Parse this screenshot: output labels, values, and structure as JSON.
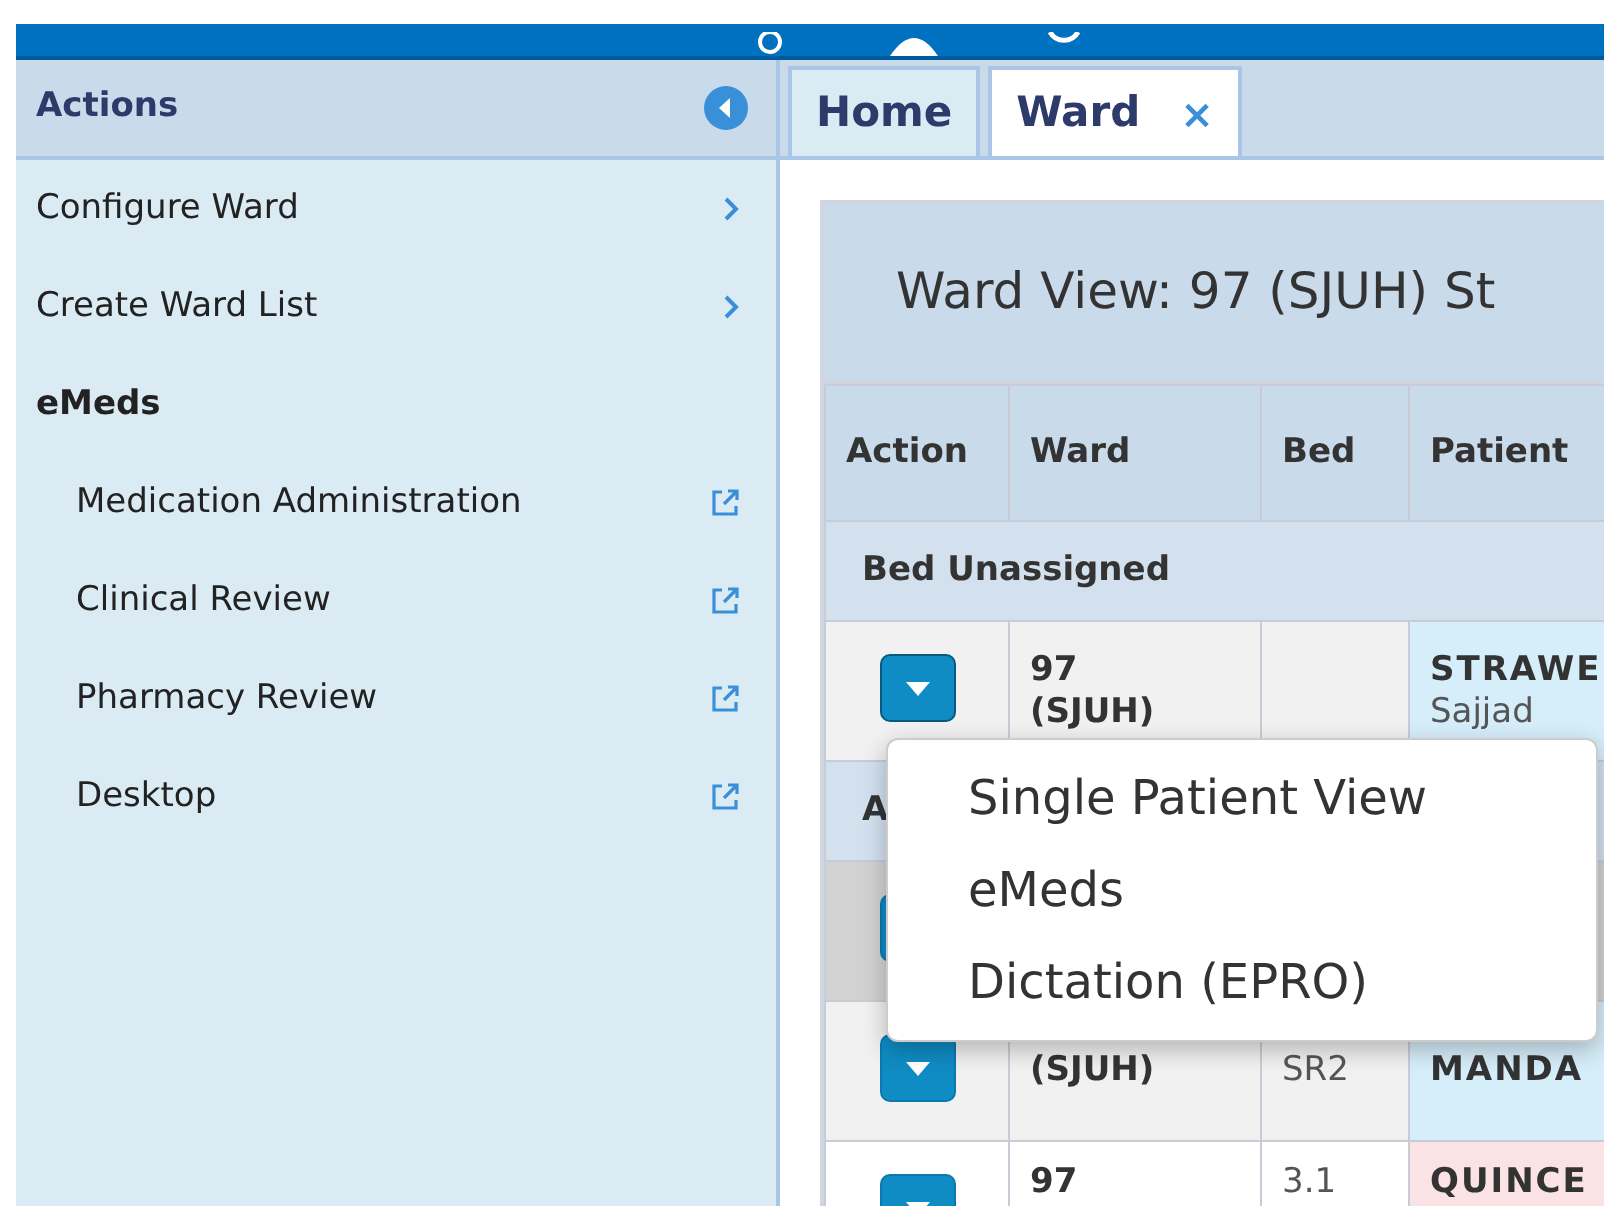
{
  "sidebar": {
    "title": "Actions",
    "items": [
      {
        "label": "Configure Ward",
        "kind": "submenu"
      },
      {
        "label": "Create Ward List",
        "kind": "submenu"
      },
      {
        "label": "eMeds",
        "kind": "section",
        "children": [
          {
            "label": "Medication Administration",
            "kind": "external"
          },
          {
            "label": "Clinical Review",
            "kind": "external"
          },
          {
            "label": "Pharmacy Review",
            "kind": "external"
          },
          {
            "label": "Desktop",
            "kind": "external"
          }
        ]
      }
    ]
  },
  "tabs": [
    {
      "label": "Home",
      "selected": false,
      "closable": false
    },
    {
      "label": "Ward",
      "selected": true,
      "closable": true,
      "close_glyph": "×"
    }
  ],
  "ward_view": {
    "title": "Ward View: 97 (SJUH) St",
    "columns": [
      "Action",
      "Ward",
      "Bed",
      "Patient"
    ],
    "rows": [
      {
        "kind": "group",
        "label": "Bed Unassigned"
      },
      {
        "kind": "patient",
        "selected": false,
        "ward": [
          "97",
          "(SJUH)"
        ],
        "bed": "",
        "patient_name": "STRAWE",
        "patient_detail": "Sajjad",
        "color": "#d6eefa",
        "menu_open": true
      },
      {
        "kind": "group",
        "label": "A"
      },
      {
        "kind": "patient",
        "selected": true,
        "ward": [],
        "bed": "",
        "patient_name": "",
        "patient_detail": "",
        "menu_open": false
      },
      {
        "kind": "patient",
        "selected": false,
        "ward": [
          "(SJUH)"
        ],
        "bed": "SR2",
        "patient_name": "MANDA",
        "patient_detail": "",
        "color": "#d6eefa",
        "menu_open": false
      },
      {
        "kind": "patient",
        "selected": false,
        "ward": [
          "97"
        ],
        "bed": "3.1",
        "patient_name": "QUINCE",
        "patient_detail": "",
        "color": "#fbe2e5",
        "menu_open": false
      }
    ]
  },
  "action_menu": {
    "items": [
      "Single Patient View",
      "eMeds",
      "Dictation (EPRO)"
    ]
  }
}
